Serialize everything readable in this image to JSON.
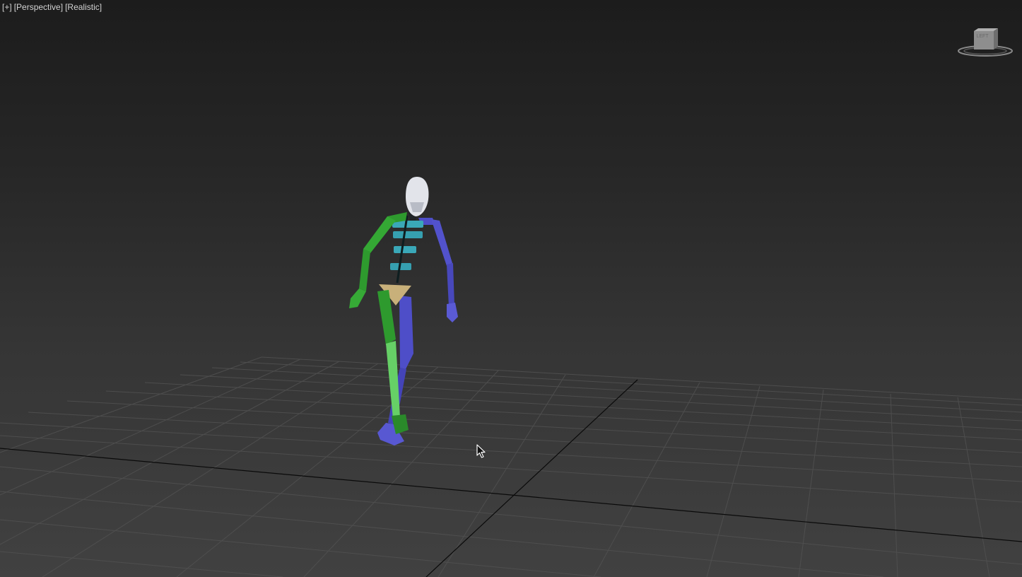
{
  "viewport": {
    "menu_plus": "[+]",
    "view_type": "[Perspective]",
    "shading_mode": "[Realistic]"
  },
  "viewcube": {
    "face_label": "LEFT"
  },
  "colors": {
    "background_top": "#1c1c1c",
    "background_bottom": "#414141",
    "grid_line": "#505050",
    "grid_axis": "#0a0a0a",
    "rig_left_side": "#2e9a2e",
    "rig_right_side": "#4e4ec8",
    "rig_spine": "#3aa8b8",
    "rig_pelvis": "#c8b07a",
    "rig_head": "#e2e4ea"
  },
  "icons": {
    "cursor": "arrow-cursor-icon",
    "navigation": "viewcube-icon"
  }
}
